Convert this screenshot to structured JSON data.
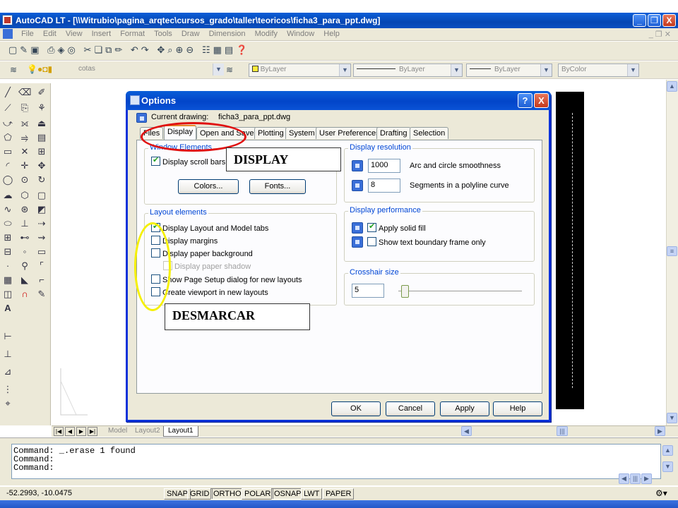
{
  "window": {
    "title": "AutoCAD LT - [\\\\Witrubio\\pagina_arqtec\\cursos_grado\\taller\\teoricos\\ficha3_para_ppt.dwg]",
    "minimize": "_",
    "restore": "❐",
    "close": "X"
  },
  "menu": [
    "File",
    "Edit",
    "View",
    "Insert",
    "Format",
    "Tools",
    "Draw",
    "Dimension",
    "Modify",
    "Window",
    "Help"
  ],
  "layers_toolbar": {
    "layer": "cotas",
    "color": "ByLayer",
    "linetype": "ByLayer",
    "lineweight": "ByLayer",
    "plotstyle": "ByColor"
  },
  "layout_tabs": [
    "Model",
    "Layout2",
    "Layout1"
  ],
  "active_layout": "Layout1",
  "command_lines": [
    "Command:  _.erase 1 found",
    "Command:",
    "Command:"
  ],
  "status": {
    "coords": "-52.2993, -10.0475",
    "toggles": [
      "SNAP",
      "GRID",
      "ORTHO",
      "POLAR",
      "OSNAP",
      "LWT",
      "PAPER"
    ]
  },
  "dialog": {
    "title": "Options",
    "help": "?",
    "close": "X",
    "current_drawing_label": "Current drawing:",
    "current_drawing_value": "ficha3_para_ppt.dwg",
    "tabs": [
      "Files",
      "Display",
      "Open and Save",
      "Plotting",
      "System",
      "User Preferences",
      "Drafting",
      "Selection"
    ],
    "active_tab": "Display",
    "window_elements": {
      "label": "Window Elements",
      "scroll_bars": "Display scroll bars in drawing window",
      "scroll_bars_visible": "Display scroll bars in",
      "colors_button": "Colors...",
      "fonts_button": "Fonts..."
    },
    "layout_elements": {
      "label": "Layout elements",
      "items": [
        {
          "label": "Display Layout and Model tabs",
          "checked": true,
          "disabled": false
        },
        {
          "label": "Display margins",
          "checked": false,
          "disabled": false
        },
        {
          "label": "Display paper background",
          "checked": false,
          "disabled": false
        },
        {
          "label": "Display paper shadow",
          "checked": false,
          "disabled": true
        },
        {
          "label": "Show Page Setup dialog for new layouts",
          "checked": false,
          "disabled": false
        },
        {
          "label": "Create viewport in new layouts",
          "checked": false,
          "disabled": false
        }
      ]
    },
    "display_resolution": {
      "label": "Display resolution",
      "arc_value": "1000",
      "arc_label": "Arc and circle smoothness",
      "polyline_value": "8",
      "polyline_label": "Segments in a polyline curve"
    },
    "display_performance": {
      "label": "Display performance",
      "apply_solid_fill": "Apply solid fill",
      "show_text_boundary": "Show text boundary frame only"
    },
    "crosshair": {
      "label": "Crosshair size",
      "value": "5"
    },
    "buttons": {
      "ok": "OK",
      "cancel": "Cancel",
      "apply": "Apply",
      "help": "Help"
    }
  },
  "annotations": {
    "display_callout": "DISPLAY",
    "desmarcar_callout": "DESMARCAR"
  }
}
